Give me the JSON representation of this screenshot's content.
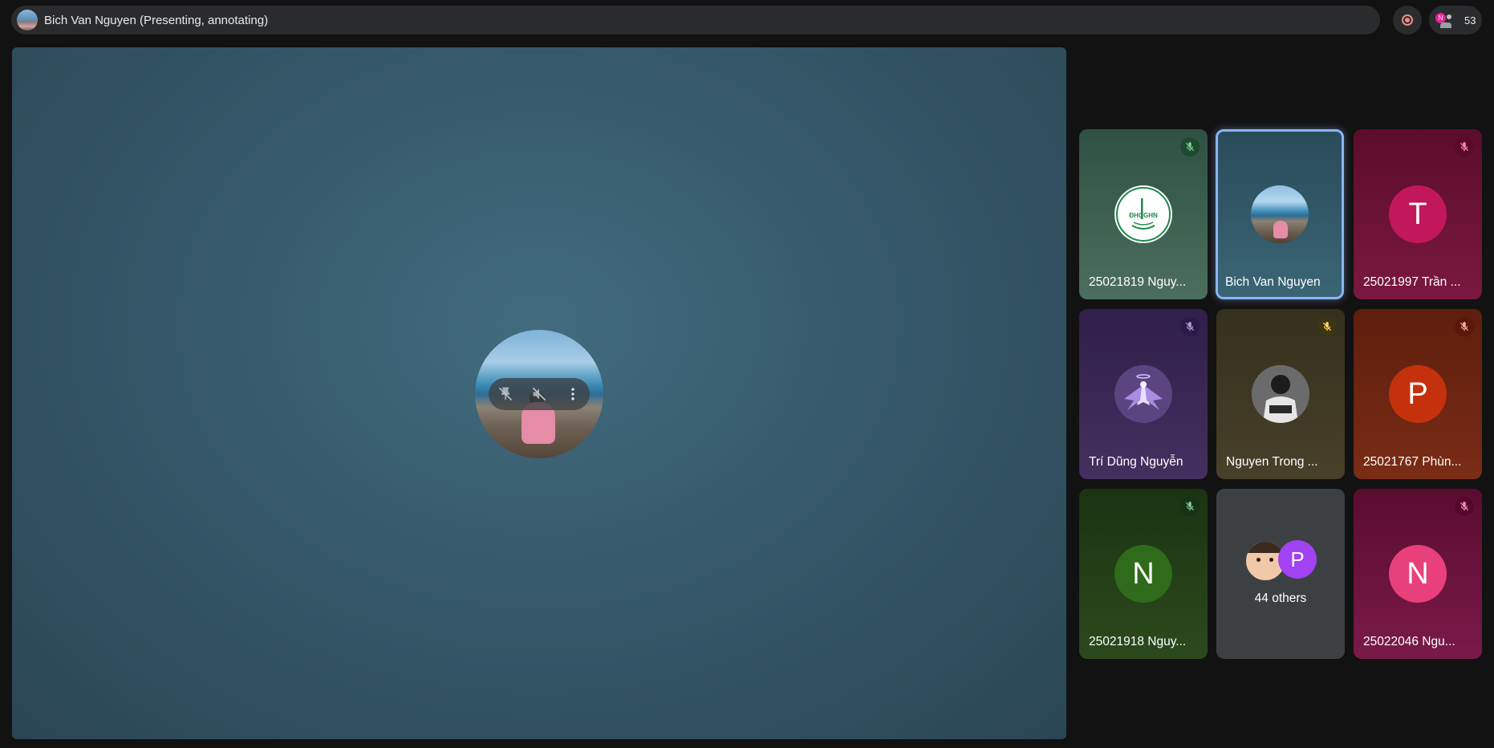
{
  "header": {
    "presenter_title": "Bich Van Nguyen (Presenting, annotating)",
    "participant_count": "53",
    "mini_avatar_letter": "N"
  },
  "stage": {
    "controls": [
      "pin-off-icon",
      "volume-off-icon",
      "more-vert-icon"
    ],
    "zoom_controls": [
      "zoom-in-icon",
      "open-in-new-icon",
      "fullscreen-icon"
    ]
  },
  "tiles": [
    {
      "name": "25021819 Nguy...",
      "avatar_type": "logo",
      "logo_text": "ĐHQGHN",
      "mic_color": "#81c995",
      "bg": "#3a5a4c"
    },
    {
      "name": "Bich Van Nguyen",
      "avatar_type": "photo",
      "selected": true,
      "bg": "#2f5565"
    },
    {
      "name": "25021997 Trần ...",
      "avatar_type": "letter",
      "letter": "T",
      "avatar_color": "#c2185b",
      "mic_color": "#f48fb1",
      "bg": "#6d0f33"
    },
    {
      "name": "Trí Dũng Nguyễn",
      "avatar_type": "image",
      "mic_color": "#b39ddb",
      "bg": "#3a2456"
    },
    {
      "name": "Nguyen Trong ...",
      "avatar_type": "image",
      "mic_color": "#fdd663",
      "bg": "#3e3522"
    },
    {
      "name": "25021767 Phùn...",
      "avatar_type": "letter",
      "letter": "P",
      "avatar_color": "#c5310d",
      "mic_color": "#f6aea9",
      "bg": "#6b2410"
    },
    {
      "name": "25021918 Nguy...",
      "avatar_type": "letter",
      "letter": "N",
      "avatar_color": "#2e6b1a",
      "mic_color": "#81c995",
      "bg": "#1f3a14"
    },
    {
      "name": "44 others",
      "avatar_type": "group",
      "letter": "P",
      "avatar_color": "#a142f4",
      "bg": "#3c4043"
    },
    {
      "name": "25022046 Ngu...",
      "avatar_type": "letter",
      "letter": "N",
      "avatar_color": "#e8407a",
      "mic_color": "#f48fb1",
      "bg": "#6d0f3c"
    }
  ]
}
